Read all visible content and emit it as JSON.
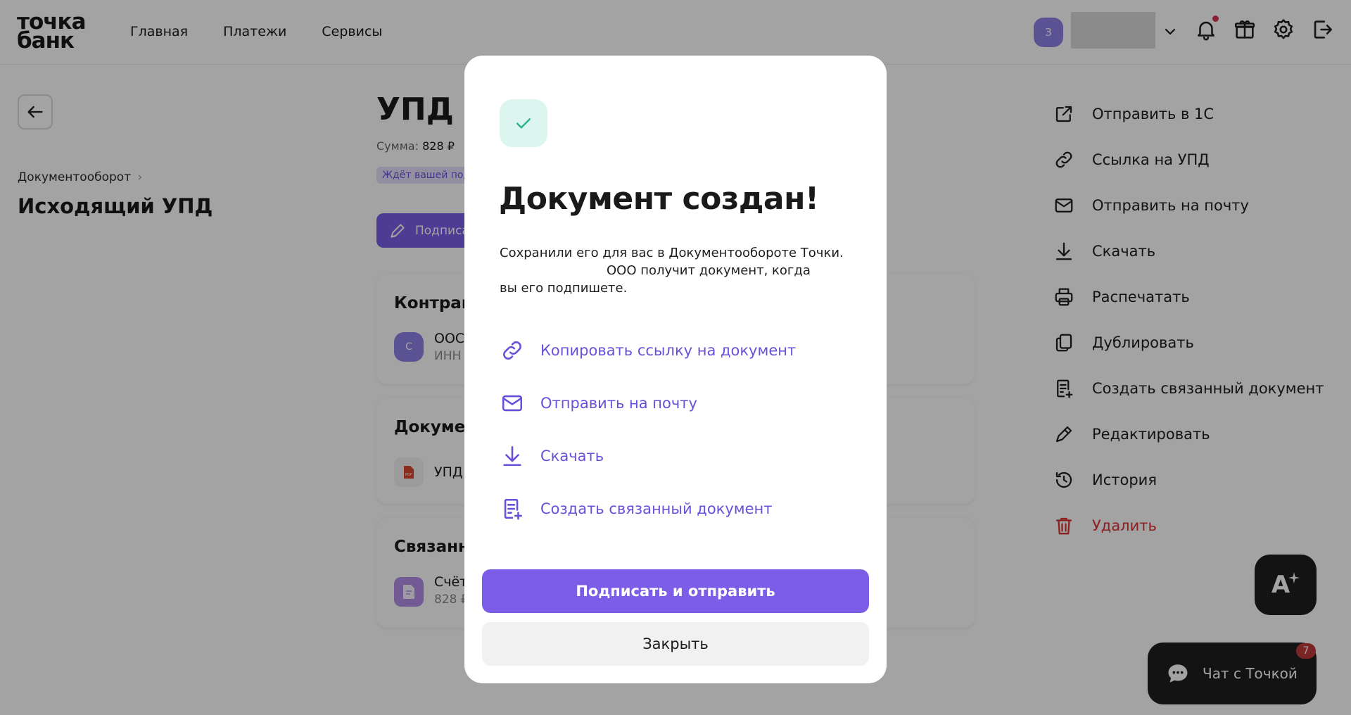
{
  "header": {
    "logo_line1": "точка",
    "logo_line2": "банк",
    "nav": [
      "Главная",
      "Платежи",
      "Сервисы"
    ],
    "avatar_letter": "З",
    "icons": [
      "chevron-down-icon",
      "bell-icon",
      "gift-icon",
      "gear-icon",
      "logout-icon"
    ]
  },
  "left": {
    "breadcrumb": "Документооборот",
    "title": "Исходящий УПД"
  },
  "document": {
    "title": "УПД N",
    "sum_label": "Сумма:",
    "sum_value": "828 ₽",
    "status": "Ждёт вашей под",
    "sign_button": "Подписа",
    "counterparty": {
      "heading": "Контраге",
      "avatar": "С",
      "name": "ООС",
      "inn": "ИНН"
    },
    "documents": {
      "heading": "Докумен",
      "file_name": "УПД"
    },
    "related": {
      "heading": "Связанн",
      "name": "Счёт",
      "sum": "828 ₽"
    }
  },
  "actions": [
    {
      "label": "Отправить в 1С",
      "icon": "export-icon"
    },
    {
      "label": "Ссылка на УПД",
      "icon": "link-icon"
    },
    {
      "label": "Отправить на почту",
      "icon": "mail-icon"
    },
    {
      "label": "Скачать",
      "icon": "download-icon"
    },
    {
      "label": "Распечатать",
      "icon": "printer-icon"
    },
    {
      "label": "Дублировать",
      "icon": "copy-icon"
    },
    {
      "label": "Создать связанный документ",
      "icon": "doc-plus-icon"
    },
    {
      "label": "Редактировать",
      "icon": "pencil-icon"
    },
    {
      "label": "История",
      "icon": "history-icon"
    },
    {
      "label": "Удалить",
      "icon": "trash-icon"
    }
  ],
  "floating": {
    "ai_label": "A",
    "chat_label": "Чат с Точкой",
    "chat_badge": "7"
  },
  "modal": {
    "title": "Документ создан!",
    "text_line1": "Сохранили его для вас в Документообороте Точки.",
    "text_line2": "ООО получит документ, когда",
    "text_line3": "вы его подпишете.",
    "links": [
      {
        "label": "Копировать ссылку на документ",
        "icon": "link-icon"
      },
      {
        "label": "Отправить на почту",
        "icon": "mail-icon"
      },
      {
        "label": "Скачать",
        "icon": "download-icon"
      },
      {
        "label": "Создать связанный документ",
        "icon": "doc-plus-icon"
      }
    ],
    "primary_button": "Подписать и отправить",
    "secondary_button": "Закрыть"
  },
  "colors": {
    "accent": "#7b5de8",
    "link": "#6a4fd8",
    "danger": "#d9302f",
    "success_bg": "#dcf6ef",
    "success": "#2fb38a"
  }
}
